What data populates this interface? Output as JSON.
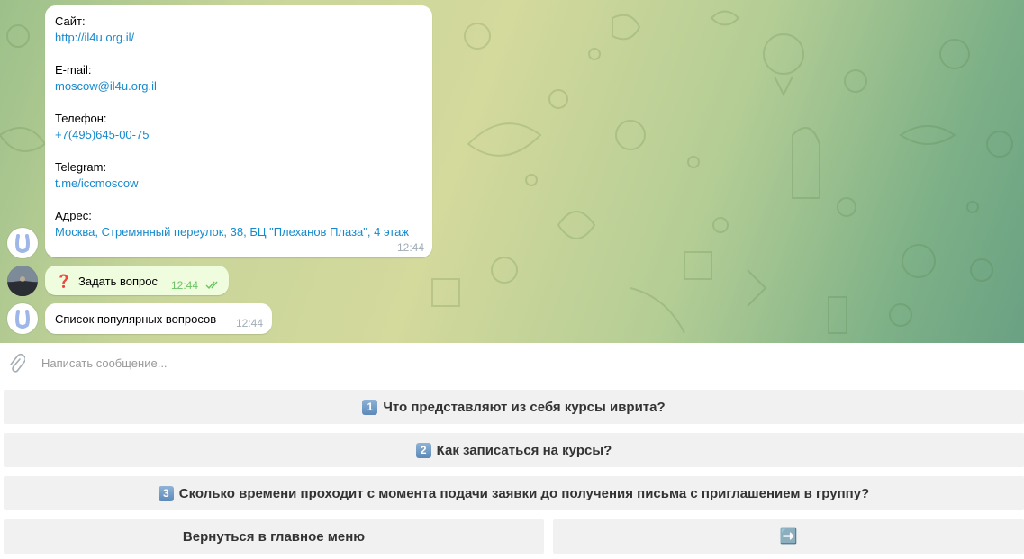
{
  "messages": {
    "contacts": {
      "site_label": "Сайт:",
      "site_value": "http://il4u.org.il/",
      "email_label": "E-mail:",
      "email_value": "moscow@il4u.org.il",
      "phone_label": "Телефон:",
      "phone_value": "+7(495)645-00-75",
      "telegram_label": "Telegram:",
      "telegram_value": "t.me/iccmoscow",
      "address_label": "Адрес:",
      "address_value": "Москва, Стремянный переулок, 38, БЦ \"Плеханов Плаза\", 4 этаж",
      "time": "12:44"
    },
    "user_question": {
      "icon": "❓",
      "text": "Задать вопрос",
      "time": "12:44"
    },
    "popular_questions": {
      "text": "Список популярных вопросов",
      "time": "12:44"
    }
  },
  "input": {
    "placeholder": "Написать сообщение..."
  },
  "keyboard": {
    "q1_icon": "1",
    "q1_label": "Что представляют из себя курсы иврита?",
    "q2_icon": "2",
    "q2_label": "Как записаться на курсы?",
    "q3_icon": "3",
    "q3_label": "Сколько времени проходит с момента подачи заявки до получения письма с приглашением в группу?",
    "back_label": "Вернуться в главное меню",
    "next_icon": "➡️"
  }
}
